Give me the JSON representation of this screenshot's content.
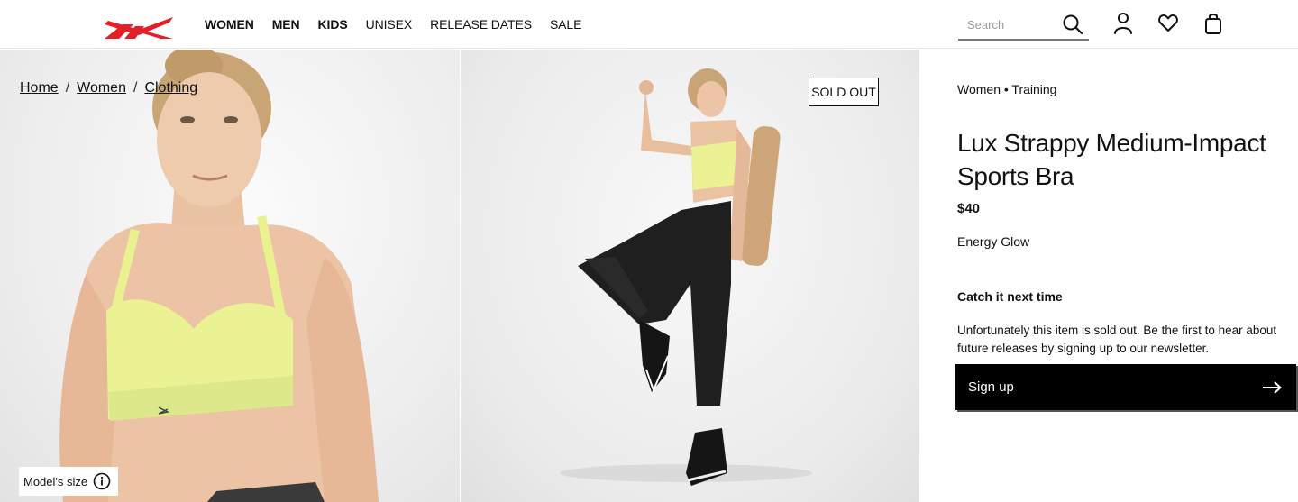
{
  "header": {
    "logo_name": "reebok-logo",
    "nav": [
      {
        "label": "WOMEN",
        "bold": true
      },
      {
        "label": "MEN",
        "bold": true
      },
      {
        "label": "KIDS",
        "bold": true
      },
      {
        "label": "UNISEX",
        "bold": false
      },
      {
        "label": "RELEASE DATES",
        "bold": false
      },
      {
        "label": "SALE",
        "bold": false
      }
    ],
    "search": {
      "placeholder": "Search",
      "value": ""
    },
    "icons": [
      "search-icon",
      "account-icon",
      "wishlist-heart-icon",
      "shopping-bag-icon"
    ]
  },
  "gallery": {
    "breadcrumb": [
      "Home",
      "Women",
      "Clothing"
    ],
    "breadcrumb_separator": "/",
    "badge": "SOLD OUT",
    "models_size_label": "Model's size"
  },
  "product": {
    "category": "Women • Training",
    "title": "Lux Strappy Medium-Impact Sports Bra",
    "price": "$40",
    "color": "Energy Glow",
    "notify_heading": "Catch it next time",
    "notify_text": "Unfortunately this item is sold out. Be the first to hear about future releases by signing up to our newsletter.",
    "signup_label": "Sign up"
  },
  "colors": {
    "brand_red": "#e41f26",
    "bra_yellow": "#e9f28f",
    "button_black": "#000000"
  }
}
